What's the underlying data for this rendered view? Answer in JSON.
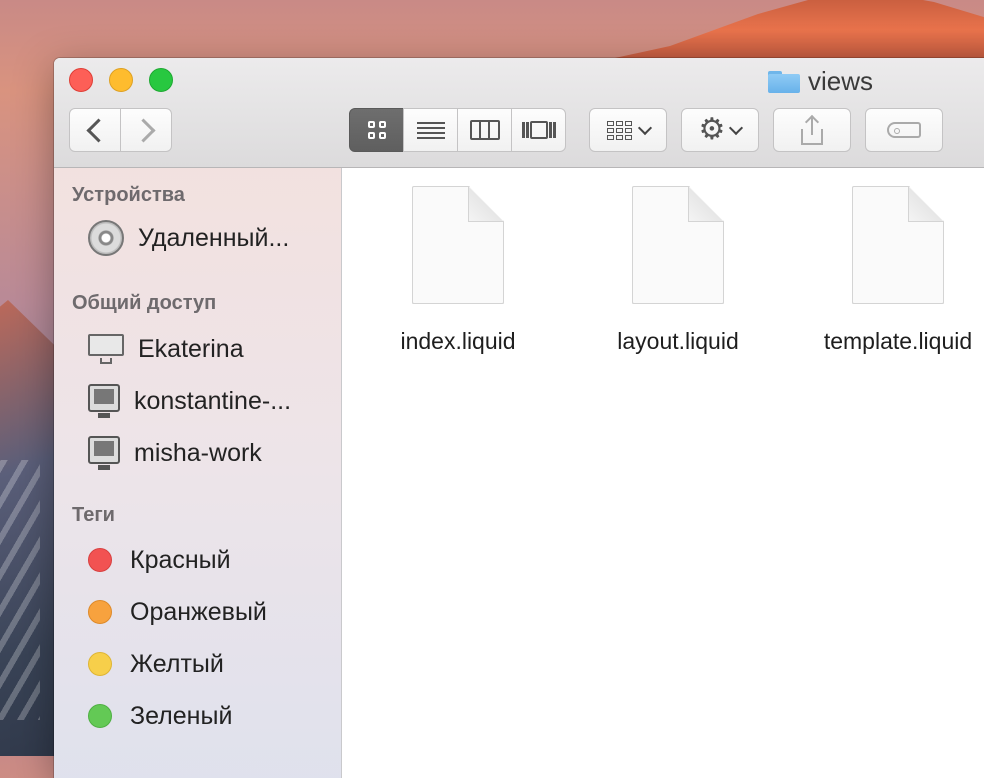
{
  "window": {
    "title": "views"
  },
  "toolbar": {
    "view_modes": [
      "icon",
      "list",
      "column",
      "coverflow"
    ],
    "active_view": "icon"
  },
  "sidebar": {
    "sections": [
      {
        "header": "Устройства",
        "items": [
          {
            "label": "Удаленный...",
            "icon": "disk-icon"
          }
        ]
      },
      {
        "header": "Общий доступ",
        "items": [
          {
            "label": "Ekaterina",
            "icon": "imac-icon"
          },
          {
            "label": "konstantine-...",
            "icon": "monitor-icon"
          },
          {
            "label": "misha-work",
            "icon": "monitor-icon"
          }
        ]
      },
      {
        "header": "Теги",
        "items": [
          {
            "label": "Красный",
            "color": "#f25252"
          },
          {
            "label": "Оранжевый",
            "color": "#f7a23e"
          },
          {
            "label": "Желтый",
            "color": "#f7cf4a"
          },
          {
            "label": "Зеленый",
            "color": "#63c955"
          }
        ]
      }
    ]
  },
  "files": [
    {
      "name": "index.liquid"
    },
    {
      "name": "layout.liquid"
    },
    {
      "name": "template.liquid"
    }
  ]
}
